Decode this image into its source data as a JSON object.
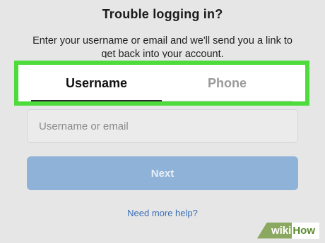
{
  "header": {
    "title": "Trouble logging in?",
    "description": "Enter your username or email and we'll send you a link to get back into your account."
  },
  "tabs": [
    {
      "label": "Username",
      "active": true
    },
    {
      "label": "Phone",
      "active": false
    }
  ],
  "form": {
    "input_placeholder": "Username or email",
    "input_value": "",
    "next_label": "Next"
  },
  "footer": {
    "help_link": "Need more help?"
  },
  "watermark": {
    "wiki": "wiki",
    "how": "How"
  },
  "colors": {
    "highlight_border": "#4ddc3c",
    "next_button": "#8fb2d8",
    "link": "#3c6fb5"
  }
}
